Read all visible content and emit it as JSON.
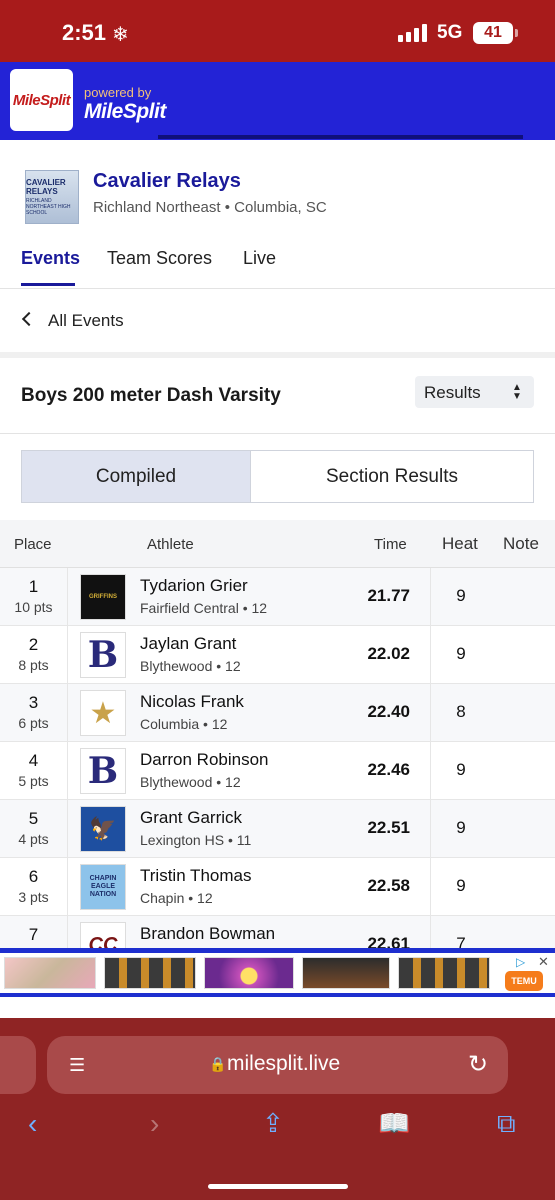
{
  "status": {
    "time": "2:51",
    "network": "5G",
    "battery": "41"
  },
  "header": {
    "logo_text": "MileSplit",
    "powered_by": "powered by",
    "brand": "MileSplit"
  },
  "meet": {
    "logo_line1": "CAVALIER RELAYS",
    "logo_line2": "RICHLAND NORTHEAST HIGH SCHOOL",
    "title": "Cavalier Relays",
    "subtitle": "Richland Northeast • Columbia, SC"
  },
  "tabs": [
    {
      "label": "Events",
      "active": true
    },
    {
      "label": "Team Scores",
      "active": false
    },
    {
      "label": "Live",
      "active": false
    }
  ],
  "nav": {
    "back_label": "All Events"
  },
  "event": {
    "title": "Boys 200 meter Dash Varsity",
    "view_select": "Results"
  },
  "segments": {
    "compiled": "Compiled",
    "section": "Section Results"
  },
  "table": {
    "headers": {
      "place": "Place",
      "athlete": "Athlete",
      "time": "Time",
      "heat": "Heat",
      "note": "Note"
    },
    "rows": [
      {
        "place": "1",
        "pts": "10 pts",
        "name": "Tydarion Grier",
        "team": "Fairfield Central • 12",
        "time": "21.77",
        "heat": "9",
        "logo": "GRIFFINS"
      },
      {
        "place": "2",
        "pts": "8 pts",
        "name": "Jaylan Grant",
        "team": "Blythewood • 12",
        "time": "22.02",
        "heat": "9",
        "logo": "B"
      },
      {
        "place": "3",
        "pts": "6 pts",
        "name": "Nicolas Frank",
        "team": "Columbia • 12",
        "time": "22.40",
        "heat": "8",
        "logo": "★"
      },
      {
        "place": "4",
        "pts": "5 pts",
        "name": "Darron Robinson",
        "team": "Blythewood • 12",
        "time": "22.46",
        "heat": "9",
        "logo": "B"
      },
      {
        "place": "5",
        "pts": "4 pts",
        "name": "Grant Garrick",
        "team": "Lexington HS • 11",
        "time": "22.51",
        "heat": "9",
        "logo": "eagle"
      },
      {
        "place": "6",
        "pts": "3 pts",
        "name": "Tristin Thomas",
        "team": "Chapin • 12",
        "time": "22.58",
        "heat": "9",
        "logo": "CHAPIN EAGLE NATION"
      },
      {
        "place": "7",
        "pts": "",
        "name": "Brandon Bowman",
        "team": "",
        "time": "22.61",
        "heat": "7",
        "logo": "CC"
      }
    ]
  },
  "ad": {
    "temu_label": "TEMU"
  },
  "browser": {
    "url": "milesplit.live"
  },
  "colors": {
    "status_bg": "#a81b1b",
    "header_bg": "#2323d6",
    "accent": "#1a1a9a",
    "browser_bg": "#8f2424"
  }
}
